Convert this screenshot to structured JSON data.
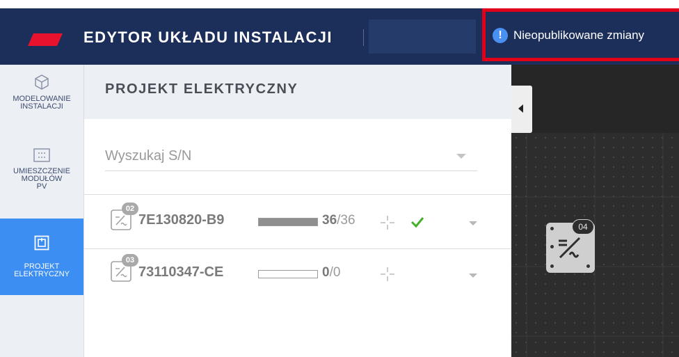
{
  "header": {
    "app_title": "EDYTOR UKŁADU INSTALACJI",
    "title_field_value": "",
    "unpublished_label": "Nieopublikowane zmiany",
    "unpublished_icon": "exclamation-icon",
    "brand_color": "#1c2f5a",
    "logo_color": "#e8122d",
    "highlight_color": "#e0001a"
  },
  "rail": {
    "items": [
      {
        "label": "MODELOWANIE\nINSTALACJI",
        "icon": "cube-icon",
        "active": false
      },
      {
        "label": "UMIESZCZENIE\nMODUŁÓW\nPV",
        "icon": "panel-grid-icon",
        "active": false
      },
      {
        "label": "PROJEKT\nELEKTRYCZNY",
        "icon": "electric-project-icon",
        "active": true
      }
    ],
    "active_color": "#3c8ef2"
  },
  "panel": {
    "title": "PROJEKT ELEKTRYCZNY",
    "search": {
      "placeholder": "Wyszukaj S/N",
      "value": ""
    },
    "inverters": [
      {
        "badge": "02",
        "serial": "7E130820-B9",
        "assigned": "36",
        "total": "/36",
        "progress": 1.0,
        "status": "check-icon"
      },
      {
        "badge": "03",
        "serial": "73110347-CE",
        "assigned": "0",
        "total": "/0",
        "progress": 0.0,
        "status": ""
      }
    ]
  },
  "canvas": {
    "node_badge": "04",
    "node_icon": "inverter-icon"
  }
}
